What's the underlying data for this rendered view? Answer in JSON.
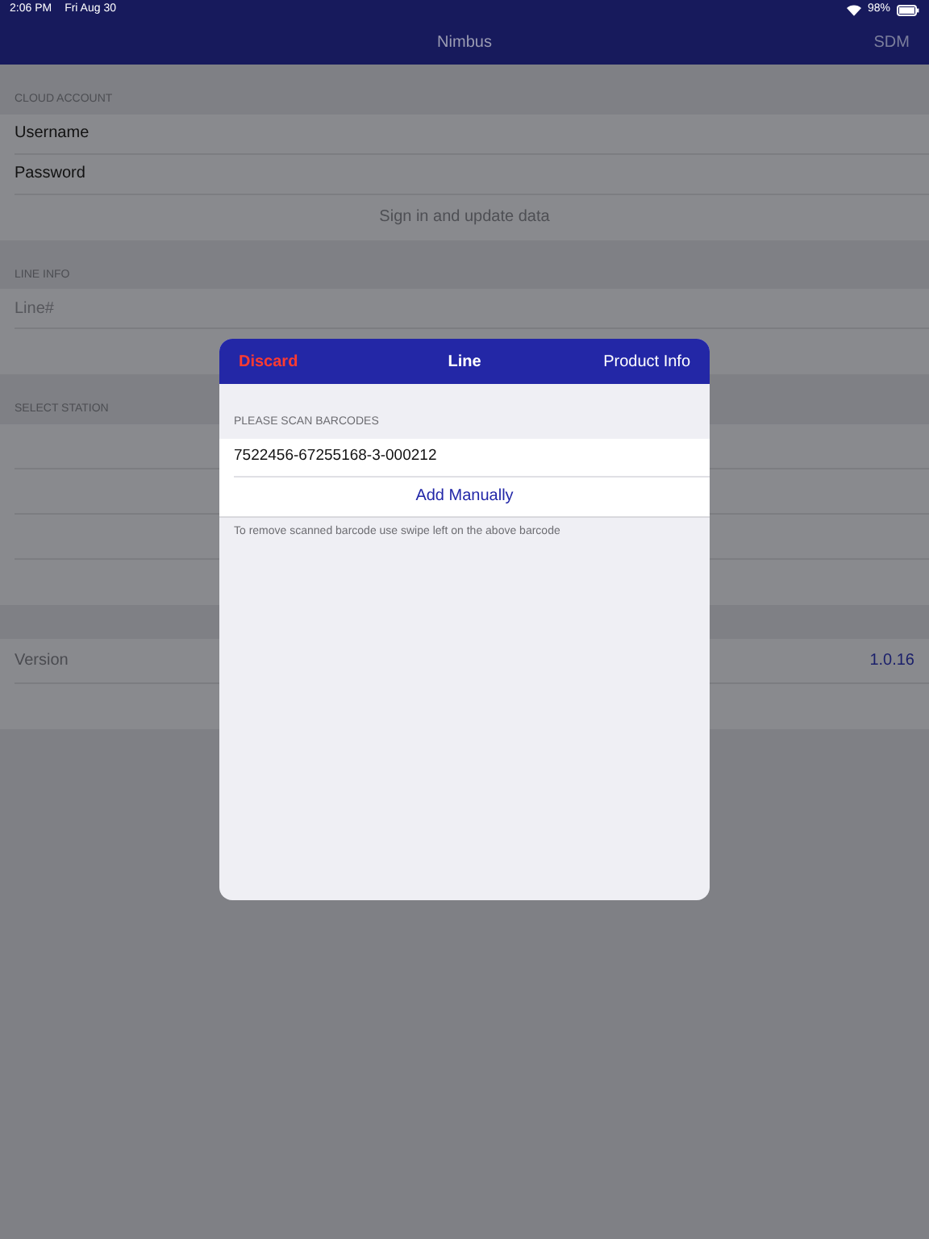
{
  "status_bar": {
    "time": "2:06 PM",
    "date": "Fri Aug 30",
    "battery": "98%"
  },
  "nav_bar": {
    "title": "Nimbus",
    "right_button": "SDM"
  },
  "sections": [
    {
      "header": "CLOUD ACCOUNT",
      "rows": [
        {
          "kind": "label",
          "text": "Username"
        },
        {
          "kind": "label",
          "text": "Password"
        },
        {
          "kind": "action",
          "text": "Sign in and update data"
        }
      ]
    },
    {
      "header": "LINE INFO",
      "rows": [
        {
          "kind": "field",
          "placeholder": "Line#"
        },
        {
          "kind": "empty"
        }
      ]
    },
    {
      "header": "SELECT STATION",
      "rows": [
        {
          "kind": "empty"
        },
        {
          "kind": "empty"
        },
        {
          "kind": "empty"
        },
        {
          "kind": "empty"
        }
      ]
    },
    {
      "rows": [
        {
          "kind": "value",
          "text": "Version",
          "value": "1.0.16"
        },
        {
          "kind": "empty"
        }
      ]
    }
  ],
  "modal": {
    "left_button": "Discard",
    "title": "Line",
    "right_button": "Product Info",
    "section_header": "PLEASE SCAN BARCODES",
    "barcodes": [
      "7522456-67255168-3-000212"
    ],
    "add_button": "Add Manually",
    "footer": "To remove scanned barcode use swipe left on the above barcode"
  }
}
